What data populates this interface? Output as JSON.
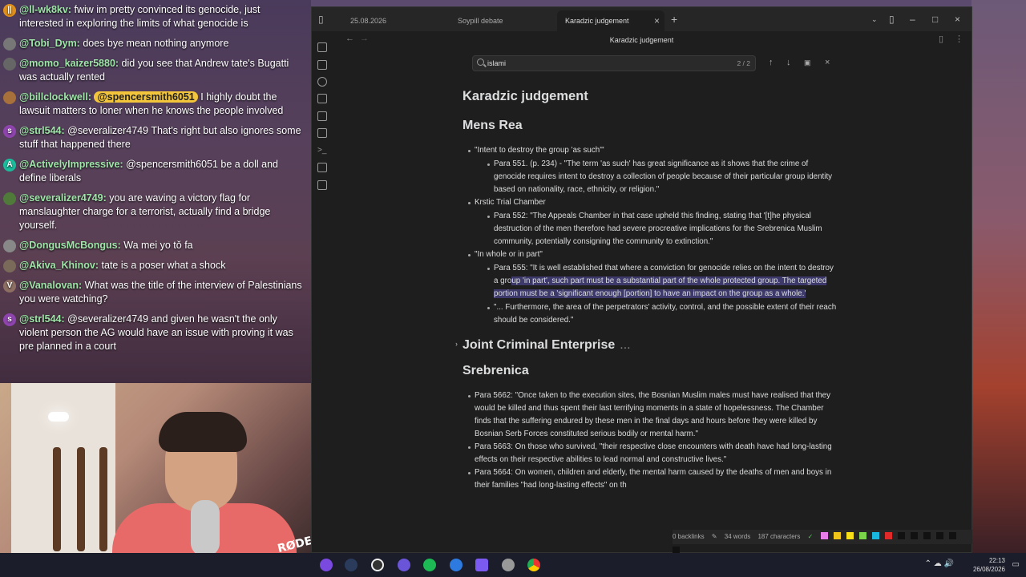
{
  "chat": {
    "messages": [
      {
        "user": "@ll-wk8kv:",
        "text": "fwiw im pretty convinced its genocide, just interested in exploring the limits of what genocide is",
        "av_color": "#e0901a",
        "av": "||"
      },
      {
        "user": "@Tobi_Dym:",
        "text": "does bye mean nothing anymore",
        "av_color": "#777",
        "av": ""
      },
      {
        "user": "@momo_kaizer5880:",
        "text": "did you see that Andrew tate's Bugatti was actually rented",
        "av_color": "#666",
        "av": ""
      },
      {
        "user": "@billclockwell:",
        "mention": "@spencersmith6051",
        "text": "I highly doubt the lawsuit matters to loner when he knows the people involved",
        "av_color": "#a8703a",
        "av": ""
      },
      {
        "user": "@strl544:",
        "text": "@severalizer4749 That's right but also ignores some stuff that happened there",
        "av_color": "#8e44ad",
        "av": "s"
      },
      {
        "user": "@ActivelyImpressive:",
        "text": "@spencersmith6051 be a doll and define liberals",
        "av_color": "#1abc9c",
        "av": "A"
      },
      {
        "user": "@severalizer4749:",
        "text": "you are waving a victory flag for manslaughter charge for a terrorist, actually find a bridge yourself.",
        "av_color": "#4f7a3a",
        "av": ""
      },
      {
        "user": "@DongusMcBongus:",
        "text": "Wa mei yo tǒ fa",
        "av_color": "#888",
        "av": ""
      },
      {
        "user": "@Akiva_Khinov:",
        "text": "tate is a poser what a shock",
        "av_color": "#7a6a5a",
        "av": ""
      },
      {
        "user": "@Vanalovan:",
        "text": "What was the title of the interview of Palestinians you were watching?",
        "av_color": "#8d6e63",
        "av": "V"
      },
      {
        "user": "@strl544:",
        "text": "@severalizer4749 and given he wasn't the only violent person the AG would have an issue with proving it was pre planned in a court",
        "av_color": "#8e44ad",
        "av": "s"
      }
    ]
  },
  "webcam": {
    "mic_brand": "RØDE"
  },
  "tabs": [
    {
      "label": "25.08.2026"
    },
    {
      "label": "Soypill debate"
    },
    {
      "label": "Karadzic judgement"
    }
  ],
  "nav": {
    "title": "Karadzic judgement"
  },
  "search": {
    "value": "islami",
    "count": "2 / 2"
  },
  "doc": {
    "title": "Karadzic judgement",
    "mens_rea": {
      "heading": "Mens Rea",
      "b1": "\"Intent to destroy the group 'as such'\"",
      "b1_sub": "Para 551. (p. 234) - \"The term 'as such' has great significance as it shows that the crime of genocide requires intent to destroy a collection of people because of their particular group identity based on nationality, race, ethnicity, or religion.\"",
      "b2": "Krstic Trial Chamber",
      "b2_sub": "Para 552: \"The Appeals Chamber in that case upheld this finding, stating that '[t]he physical destruction of the men therefore had severe procreative implications for the Srebrenica Muslim community, potentially consigning the community to extinction.\"",
      "b3": "\"In whole or in part\"",
      "b3_sub1_pre": "Para 555: \"It is well established that where a conviction for genocide relies on the intent to destroy a gro",
      "b3_sub1_hl": "up 'in part', such part must be a substantial part of the whole protected group. The targeted portion must be a 'significant enough [portion] to have an impact on the group as a whole.'",
      "b3_sub2": "\"... Furthermore, the area of the perpetrators' activity, control, and the possible extent of their reach should be considered.\""
    },
    "jce": {
      "heading": "Joint Criminal Enterprise",
      "dots": "..."
    },
    "srebrenica": {
      "heading": "Srebrenica",
      "p1": "Para 5662: \"Once taken to the execution sites, the Bosnian Muslim males must have realised that they would be killed and thus spent their last terrifying moments in a state of hopelessness. The Chamber finds that the suffering endured by these men in the final days and hours before they were killed by Bosnian Serb Forces constituted serious bodily or mental harm.\"",
      "p2": "Para 5663: On those who survived, \"their respective close encounters with death have had long-lasting effects on their respective abilities to lead normal and constructive lives.\"",
      "p3": "Para 5664: On women, children and elderly, the mental harm caused by the deaths of men and boys in their families \"had long-lasting effects\" on th"
    }
  },
  "status": {
    "backlinks": "0 backlinks",
    "words": "34 words",
    "chars": "187 characters"
  },
  "colors": {
    "swatches": [
      "#e87ce8",
      "#f0c419",
      "#f7e017",
      "#7bd64a",
      "#19b8e0",
      "#e02a2a",
      "#111111",
      "#111111",
      "#111111",
      "#111111",
      "#111111",
      "#111111"
    ]
  },
  "tray": {
    "time": "22:13",
    "date": "26/08/2026"
  }
}
